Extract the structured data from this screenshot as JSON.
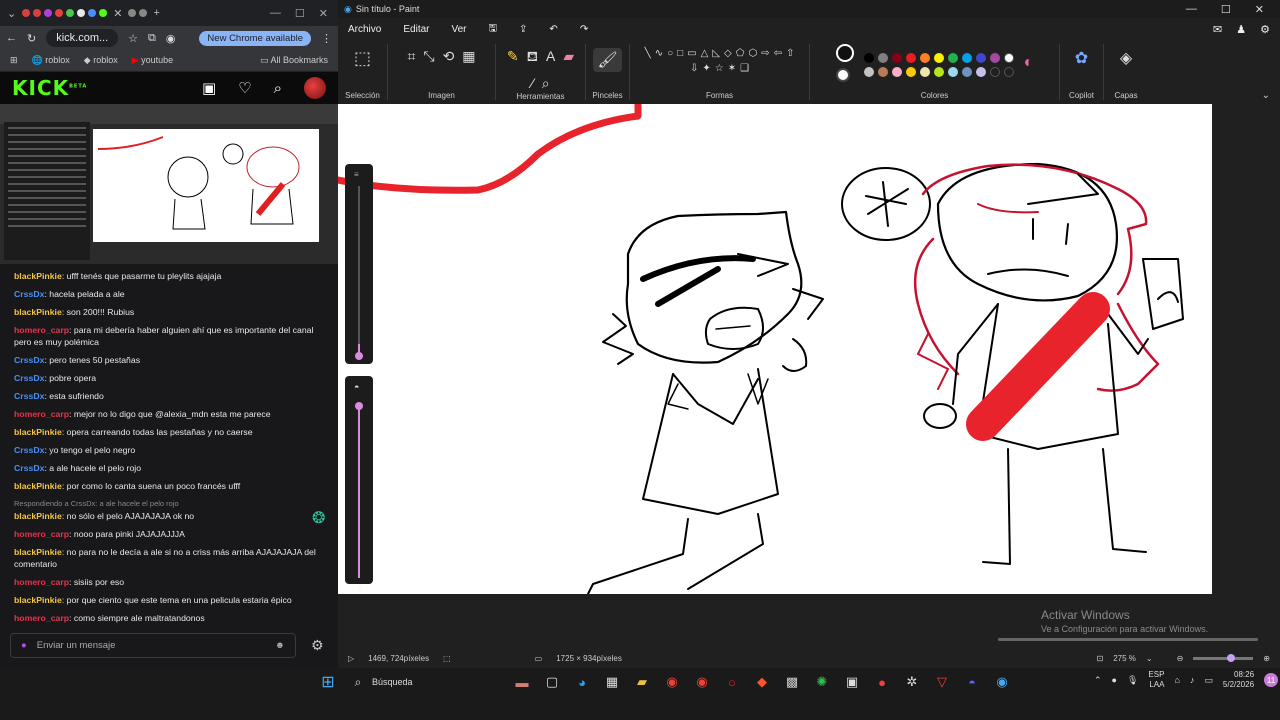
{
  "browser": {
    "url": "kick.com...",
    "update_label": "New Chrome available",
    "bookmarks": [
      "roblox",
      "roblox",
      "youtube"
    ],
    "all_bookmarks": "All Bookmarks"
  },
  "kick": {
    "logo": "KICK",
    "logo_tag": "BETA",
    "chat_placeholder": "Enviar un mensaje",
    "messages": [
      {
        "user": "blackPinkie",
        "color": "#f5c542",
        "text": ": ufff tenés que pasarme tu pleylits ajajaja"
      },
      {
        "user": "CrssDx",
        "color": "#4a8ff7",
        "text": ": hacela pelada a ale"
      },
      {
        "user": "blackPinkie",
        "color": "#f5c542",
        "text": ": son 200!!! Rubius"
      },
      {
        "user": "homero_carp",
        "color": "#e8334a",
        "text": ": para mi debería haber alguien ahí que es importante del canal pero es muy polémica"
      },
      {
        "user": "CrssDx",
        "color": "#4a8ff7",
        "text": ": pero tenes 50 pestañas"
      },
      {
        "user": "CrssDx",
        "color": "#4a8ff7",
        "text": ": pobre opera"
      },
      {
        "user": "CrssDx",
        "color": "#4a8ff7",
        "text": ": esta sufriendo"
      },
      {
        "user": "homero_carp",
        "color": "#e8334a",
        "text": ": mejor no lo digo que @alexia_mdn esta me parece"
      },
      {
        "user": "blackPinkie",
        "color": "#f5c542",
        "text": ": opera carreando todas las pestañas y no caerse"
      },
      {
        "user": "CrssDx",
        "color": "#4a8ff7",
        "text": ": yo tengo el pelo negro"
      },
      {
        "user": "CrssDx",
        "color": "#4a8ff7",
        "text": ": a ale hacele el pelo rojo"
      },
      {
        "user": "blackPinkie",
        "color": "#f5c542",
        "text": ": por como lo canta suena un poco francés ufff"
      },
      {
        "reply": "Respondiendo a CrssDx: a ale hacele el pelo rojo"
      },
      {
        "user": "blackPinkie",
        "color": "#f5c542",
        "text": ": no sólo el pelo AJAJAJAJA ok no"
      },
      {
        "user": "homero_carp",
        "color": "#e8334a",
        "text": ": nooo para pinki JAJAJAJJJA"
      },
      {
        "user": "blackPinkie",
        "color": "#f5c542",
        "text": ": no para no le decía a ale si no a criss más arriba AJAJAJAJA del comentario"
      },
      {
        "user": "homero_carp",
        "color": "#e8334a",
        "text": ": sisiis por eso"
      },
      {
        "user": "blackPinkie",
        "color": "#f5c542",
        "text": ": por que ciento que este tema en una pelicula estaria épico"
      },
      {
        "user": "homero_carp",
        "color": "#e8334a",
        "text": ": como siempre ale maltratandonos"
      }
    ]
  },
  "paint": {
    "title": "Sin título - Paint",
    "menu": [
      "Archivo",
      "Editar",
      "Ver"
    ],
    "groups": {
      "seleccion": "Selección",
      "imagen": "Imagen",
      "herramientas": "Herramientas",
      "pinceles": "Pinceles",
      "formas": "Formas",
      "colores": "Colores",
      "copilot": "Copilot",
      "capas": "Capas"
    },
    "palette": [
      "#000000",
      "#7f7f7f",
      "#880015",
      "#ed1c24",
      "#ff7f27",
      "#fff200",
      "#22b14c",
      "#00a2e8",
      "#3f48cc",
      "#a349a4",
      "#ffffff",
      "#c3c3c3",
      "#b97a57",
      "#ffaec9",
      "#ffc90e",
      "#efe4b0",
      "#b5e61d",
      "#99d9ea",
      "#7092be",
      "#c8bfe7"
    ],
    "status": {
      "cursor": "1469, 724píxeles",
      "size": "1725 × 934píxeles",
      "zoom": "275 %"
    },
    "watermark": {
      "line1": "Activar Windows",
      "line2": "Ve a Configuración para activar Windows."
    }
  },
  "taskbar": {
    "search": "Búsqueda",
    "lang": "ESP",
    "lang2": "LAA",
    "time": "08:26",
    "date": "5/2/2026",
    "badge": "11"
  }
}
